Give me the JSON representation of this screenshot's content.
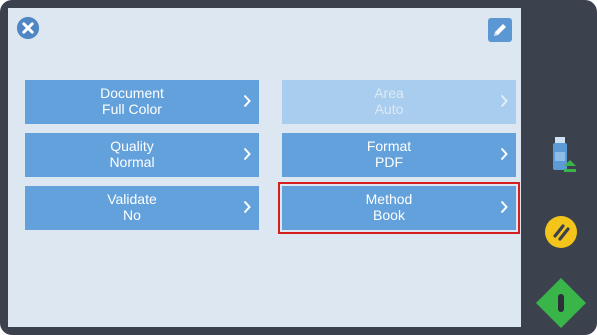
{
  "header": {
    "close_icon": "close-circle-icon",
    "edit_icon": "pencil-edit-icon"
  },
  "tiles": [
    {
      "title": "Document",
      "value": "Full Color",
      "state": "enabled"
    },
    {
      "title": "Area",
      "value": "Auto",
      "state": "disabled"
    },
    {
      "title": "Quality",
      "value": "Normal",
      "state": "enabled"
    },
    {
      "title": "Format",
      "value": "PDF",
      "state": "enabled"
    },
    {
      "title": "Validate",
      "value": "No",
      "state": "enabled"
    },
    {
      "title": "Method",
      "value": "Book",
      "state": "selected"
    }
  ],
  "sidebar": {
    "usb_icon": "usb-drive-icon",
    "pause_icon": "pause-icon",
    "start_icon": "start-icon"
  },
  "colors": {
    "frame": "#3b414d",
    "panel": "#dde7f1",
    "tile": "#62a1db",
    "tile_disabled": "#a8cdee",
    "selection_outline": "#d51f1f",
    "pause_yellow": "#f3c419",
    "start_green": "#3ab54a"
  }
}
